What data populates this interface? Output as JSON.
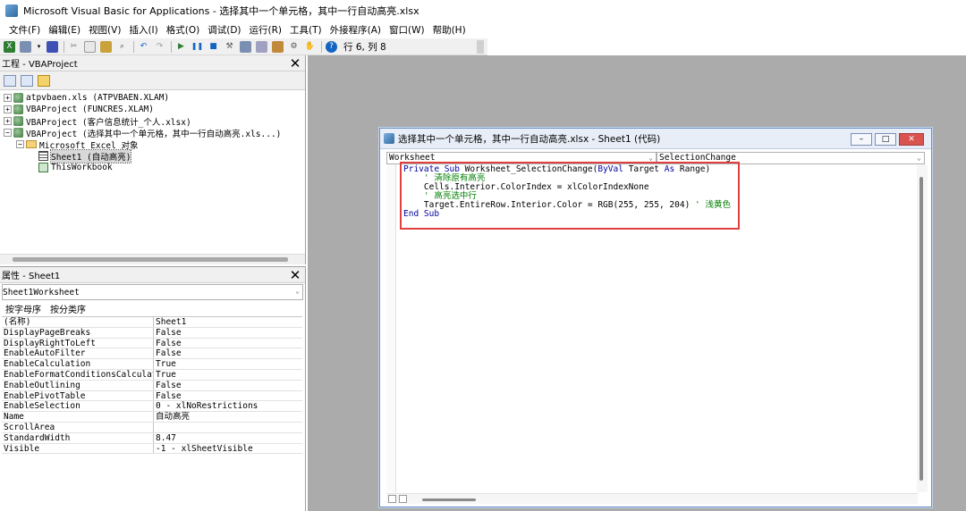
{
  "window": {
    "title": "Microsoft Visual Basic for Applications - 选择其中一个单元格，其中一行自动高亮.xlsx"
  },
  "menu": [
    "文件(F)",
    "编辑(E)",
    "视图(V)",
    "插入(I)",
    "格式(O)",
    "调试(D)",
    "运行(R)",
    "工具(T)",
    "外接程序(A)",
    "窗口(W)",
    "帮助(H)"
  ],
  "toolbar": {
    "position_text": "行 6, 列 8"
  },
  "project_panel": {
    "title": "工程 - VBAProject",
    "items": [
      {
        "text": "atpvbaen.xls (ATPVBAEN.XLAM)"
      },
      {
        "text": "VBAProject (FUNCRES.XLAM)"
      },
      {
        "text": "VBAProject (客户信息统计_个人.xlsx)"
      },
      {
        "text": "VBAProject (选择其中一个单元格，其中一行自动高亮.xls...)"
      },
      {
        "text": "Microsoft Excel 对象"
      },
      {
        "text": "Sheet1 (自动高亮)"
      },
      {
        "text": "ThisWorkbook"
      }
    ]
  },
  "props_panel": {
    "title": "属性 - Sheet1",
    "object_name": "Sheet1",
    "object_type": "Worksheet",
    "tabs": [
      "按字母序",
      "按分类序"
    ],
    "rows": [
      {
        "name": "(名称)",
        "value": "Sheet1"
      },
      {
        "name": "DisplayPageBreaks",
        "value": "False"
      },
      {
        "name": "DisplayRightToLeft",
        "value": "False"
      },
      {
        "name": "EnableAutoFilter",
        "value": "False"
      },
      {
        "name": "EnableCalculation",
        "value": "True"
      },
      {
        "name": "EnableFormatConditionsCalculatio",
        "value": "True"
      },
      {
        "name": "EnableOutlining",
        "value": "False"
      },
      {
        "name": "EnablePivotTable",
        "value": "False"
      },
      {
        "name": "EnableSelection",
        "value": "0 - xlNoRestrictions"
      },
      {
        "name": "Name",
        "value": "自动高亮"
      },
      {
        "name": "ScrollArea",
        "value": ""
      },
      {
        "name": "StandardWidth",
        "value": "8.47"
      },
      {
        "name": "Visible",
        "value": "-1 - xlSheetVisible"
      }
    ]
  },
  "code_window": {
    "title": "选择其中一个单元格，其中一行自动高亮.xlsx - Sheet1 (代码)",
    "object_select": "Worksheet",
    "proc_select": "SelectionChange",
    "lines": [
      {
        "kw1": "Private Sub",
        "rest": " Worksheet_SelectionChange(",
        "kw2": "ByVal",
        "rest2": " Target ",
        "kw3": "As",
        "rest3": " Range)"
      },
      {
        "comment": "    ' 清除原有高亮"
      },
      {
        "code": "    Cells.Interior.ColorIndex = xlColorIndexNone"
      },
      {
        "comment": "    ' 高亮选中行"
      },
      {
        "code": "    Target.EntireRow.Interior.Color = RGB(255, 255, 204) ",
        "comment": "' 浅黄色"
      },
      {
        "kw1": "End Sub"
      }
    ]
  }
}
